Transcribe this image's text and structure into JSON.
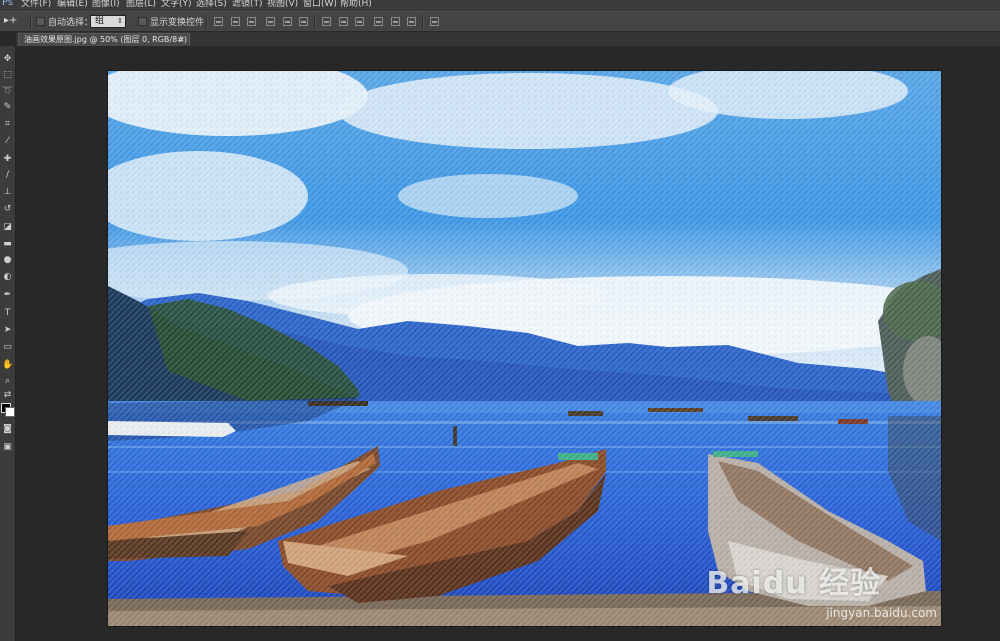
{
  "menubar": {
    "logo": "Ps",
    "items": [
      "文件(F)",
      "编辑(E)",
      "图像(I)",
      "图层(L)",
      "文字(Y)",
      "选择(S)",
      "滤镜(T)",
      "视图(V)",
      "窗口(W)",
      "帮助(H)"
    ]
  },
  "options": {
    "tool_preset": "▸+",
    "auto_select_label": "自动选择：",
    "auto_select_value": "组",
    "show_transform_label": "显示变换控件"
  },
  "document": {
    "tab_title": "油画效果原图.jpg @ 50% (图层 0, RGB/8#) *",
    "close_glyph": "×"
  },
  "watermark": {
    "brand": "Baidu 经验",
    "url": "jingyan.baidu.com"
  },
  "colors": {
    "foreground": "#000000",
    "background": "#ffffff"
  }
}
